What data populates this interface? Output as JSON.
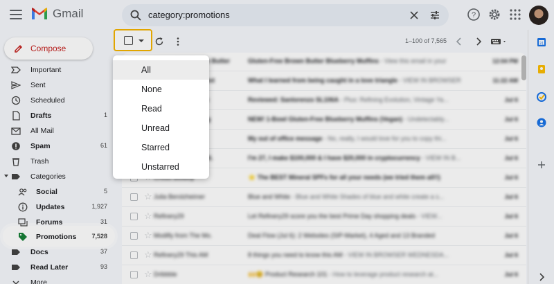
{
  "header": {
    "app_name": "Gmail",
    "search_query": "category:promotions"
  },
  "compose": {
    "label": "Compose"
  },
  "sidebar": {
    "items": [
      {
        "label": "Important",
        "count": "",
        "bold": false,
        "icon": "label-important-icon"
      },
      {
        "label": "Sent",
        "count": "",
        "bold": false,
        "icon": "send-icon"
      },
      {
        "label": "Scheduled",
        "count": "",
        "bold": false,
        "icon": "schedule-icon"
      },
      {
        "label": "Drafts",
        "count": "1",
        "bold": true,
        "icon": "draft-icon"
      },
      {
        "label": "All Mail",
        "count": "",
        "bold": false,
        "icon": "mail-icon"
      },
      {
        "label": "Spam",
        "count": "61",
        "bold": true,
        "icon": "spam-icon"
      },
      {
        "label": "Trash",
        "count": "",
        "bold": false,
        "icon": "trash-icon"
      },
      {
        "label": "Categories",
        "count": "",
        "bold": false,
        "icon": "label-icon"
      },
      {
        "label": "Social",
        "count": "5",
        "bold": true,
        "icon": "people-icon"
      },
      {
        "label": "Updates",
        "count": "1,927",
        "bold": true,
        "icon": "info-icon"
      },
      {
        "label": "Forums",
        "count": "31",
        "bold": true,
        "icon": "forum-icon"
      },
      {
        "label": "Promotions",
        "count": "7,528",
        "bold": true,
        "icon": "tag-icon"
      },
      {
        "label": "Docs",
        "count": "37",
        "bold": true,
        "icon": "label-icon"
      },
      {
        "label": "Read Later",
        "count": "93",
        "bold": true,
        "icon": "label-icon"
      },
      {
        "label": "More",
        "count": "",
        "bold": false,
        "icon": "chevron-down-icon"
      }
    ]
  },
  "toolbar": {
    "pagination": "1–100 of 7,565"
  },
  "select_menu": {
    "items": [
      "All",
      "None",
      "Read",
      "Unread",
      "Starred",
      "Unstarred"
    ],
    "highlighted": "All"
  },
  "emails": [
    {
      "sender": "Gluten-Free Brown Butter",
      "subject": "Gluten-Free Brown Butter Blueberry Muffins",
      "snippet": " - View this email in your",
      "date": "12:04 PM",
      "unread": true
    },
    {
      "sender": "Medium Daily Digest",
      "subject": "What I learned from being caught in a love triangle",
      "snippet": " - VIEW IN BROWSER",
      "date": "11:22 AM",
      "unread": true
    },
    {
      "sender": "Refinery Evolution",
      "subject": "Reviewed: Sanlorenzo SL106A",
      "snippet": " - Plus: Refining Evolution, Vintage Ya...",
      "date": "Jul 6",
      "unread": true
    },
    {
      "sender": "King Arthur Baking",
      "subject": "NEW! 1-Bowl Gluten-Free Blueberry Muffins (Vegan)",
      "snippet": " - Undetectably...",
      "date": "Jul 6",
      "unread": true
    },
    {
      "sender": "Copy Hackers",
      "subject": "My out of office message",
      "snippet": " - No, really, I would love for you to copy thi...",
      "date": "Jul 6",
      "unread": true
    },
    {
      "sender": "Brian Dean Daily St.",
      "subject": "I'm 27, I make $100,000 & I have $20,000 in cryptocurrency",
      "snippet": " - VIEW IN B...",
      "date": "Jul 6",
      "unread": true
    },
    {
      "sender": "Credo Beauty",
      "subject": "⭐ The BEST Mineral SPFs for all your needs (we tried them all!!)",
      "snippet": "",
      "date": "Jul 6",
      "unread": true
    },
    {
      "sender": "Julia Berolzheimer",
      "subject": "Blue and White",
      "snippet": " - Blue and White Shades of blue and white create a s...",
      "date": "Jul 6",
      "unread": false
    },
    {
      "sender": "Refinery29",
      "subject": "Let Refinery29 score you the best Prime Day shopping deals",
      "snippet": " - VIEW...",
      "date": "Jul 6",
      "unread": false
    },
    {
      "sender": "Modifly from The Mo.",
      "subject": "Deal Flow (Jul 6): 2 Websites (SIP-Market), 4 Aged and 13 Branded",
      "snippet": "",
      "date": "Jul 6",
      "unread": false
    },
    {
      "sender": "Refinery29 This AM",
      "subject": "8 things you need to know this AM",
      "snippet": " - VIEW IN BROWSER WEDNESDA...",
      "date": "Jul 6",
      "unread": false
    },
    {
      "sender": "Dribbble",
      "subject": "🙌😊 Product Research 101",
      "snippet": " - How to leverage product research at...",
      "date": "Jul 6",
      "unread": false
    }
  ],
  "colors": {
    "highlight_border": "#f5b400",
    "compose_text": "#c5221f",
    "promotions_icon": "#188038"
  }
}
